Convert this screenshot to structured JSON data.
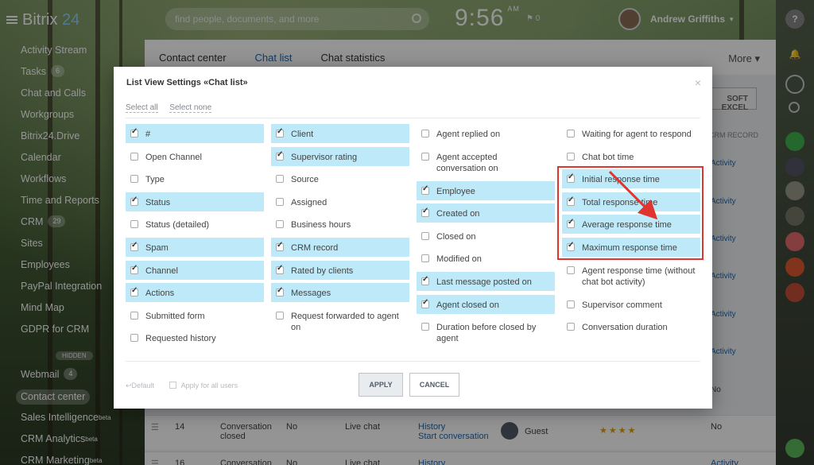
{
  "app": {
    "logo_word": "Bitrix",
    "logo_num": " 24"
  },
  "topbar": {
    "search_placeholder": "find people, documents, and more",
    "clock": "9:56",
    "clock_ampm": "AM",
    "flag_count": "0",
    "user_name": "Andrew Griffiths"
  },
  "sidebar": {
    "items": [
      {
        "label": "Activity Stream",
        "badge": ""
      },
      {
        "label": "Tasks",
        "badge": "6"
      },
      {
        "label": "Chat and Calls",
        "badge": ""
      },
      {
        "label": "Workgroups",
        "badge": ""
      },
      {
        "label": "Bitrix24.Drive",
        "badge": ""
      },
      {
        "label": "Calendar",
        "badge": ""
      },
      {
        "label": "Workflows",
        "badge": ""
      },
      {
        "label": "Time and Reports",
        "badge": ""
      },
      {
        "label": "CRM",
        "badge": "29"
      },
      {
        "label": "Sites",
        "badge": ""
      },
      {
        "label": "Employees",
        "badge": ""
      },
      {
        "label": "PayPal Integration",
        "badge": ""
      },
      {
        "label": "Mind Map",
        "badge": ""
      },
      {
        "label": "GDPR for CRM",
        "badge": ""
      }
    ],
    "hidden_label": "HIDDEN",
    "hidden_items": [
      {
        "label": "Webmail",
        "badge": "4"
      },
      {
        "label": "Contact center",
        "badge": ""
      },
      {
        "label": "Sales Intelligence",
        "sup": "beta"
      },
      {
        "label": "CRM Analytics",
        "sup": "beta"
      },
      {
        "label": "CRM Marketing",
        "sup": "beta"
      }
    ]
  },
  "main": {
    "tabs": [
      "Contact center",
      "Chat list",
      "Chat statistics"
    ],
    "more_label": "More ▾",
    "excel_button": "SOFT EXCEL",
    "crm_column": "CRM RECORD",
    "activity_label": "Activity",
    "row_no": "No",
    "row14": {
      "num": "14",
      "status": "Conversation closed",
      "spam": "No",
      "channel": "Live chat",
      "action1": "History",
      "action2": "Start conversation",
      "client": "Guest",
      "rating": "★★★★",
      "crm": "No"
    },
    "row16": {
      "num": "16",
      "status": "Conversation",
      "spam": "No",
      "channel": "Live chat",
      "action1": "History",
      "crm": "Activity"
    }
  },
  "modal": {
    "title": "List View Settings «Chat list»",
    "select_all": "Select all",
    "select_none": "Select none",
    "columns": [
      [
        {
          "label": "#",
          "checked": true
        },
        {
          "label": "Open Channel",
          "checked": false
        },
        {
          "label": "Type",
          "checked": false
        },
        {
          "label": "Status",
          "checked": true
        },
        {
          "label": "Status (detailed)",
          "checked": false
        },
        {
          "label": "Spam",
          "checked": true
        },
        {
          "label": "Channel",
          "checked": true
        },
        {
          "label": "Actions",
          "checked": true
        },
        {
          "label": "Submitted form",
          "checked": false
        },
        {
          "label": "Requested history",
          "checked": false
        }
      ],
      [
        {
          "label": "Client",
          "checked": true
        },
        {
          "label": "Supervisor rating",
          "checked": true
        },
        {
          "label": "Source",
          "checked": false
        },
        {
          "label": "Assigned",
          "checked": false
        },
        {
          "label": "Business hours",
          "checked": false
        },
        {
          "label": "CRM record",
          "checked": true
        },
        {
          "label": "Rated by clients",
          "checked": true
        },
        {
          "label": "Messages",
          "checked": true
        },
        {
          "label": "Request forwarded to agent on",
          "checked": false
        }
      ],
      [
        {
          "label": "Agent replied on",
          "checked": false
        },
        {
          "label": "Agent accepted conversation on",
          "checked": false
        },
        {
          "label": "Employee",
          "checked": true
        },
        {
          "label": "Created on",
          "checked": true
        },
        {
          "label": "Closed on",
          "checked": false
        },
        {
          "label": "Modified on",
          "checked": false
        },
        {
          "label": "Last message posted on",
          "checked": true
        },
        {
          "label": "Agent closed on",
          "checked": true
        },
        {
          "label": "Duration before closed by agent",
          "checked": false
        }
      ],
      [
        {
          "label": "Waiting for agent to respond",
          "checked": false
        },
        {
          "label": "Chat bot time",
          "checked": false
        },
        {
          "label": "Initial response time",
          "checked": true
        },
        {
          "label": "Total response time",
          "checked": true
        },
        {
          "label": "Average response time",
          "checked": true
        },
        {
          "label": "Maximum response time",
          "checked": true
        },
        {
          "label": "Agent response time (without chat bot activity)",
          "checked": false
        },
        {
          "label": "Supervisor comment",
          "checked": false
        },
        {
          "label": "Conversation duration",
          "checked": false
        }
      ]
    ],
    "default_label": "↩Default",
    "apply_all_label": "Apply for all users",
    "apply_button": "APPLY",
    "cancel_button": "CANCEL",
    "highlight_color": "#e0342e"
  }
}
